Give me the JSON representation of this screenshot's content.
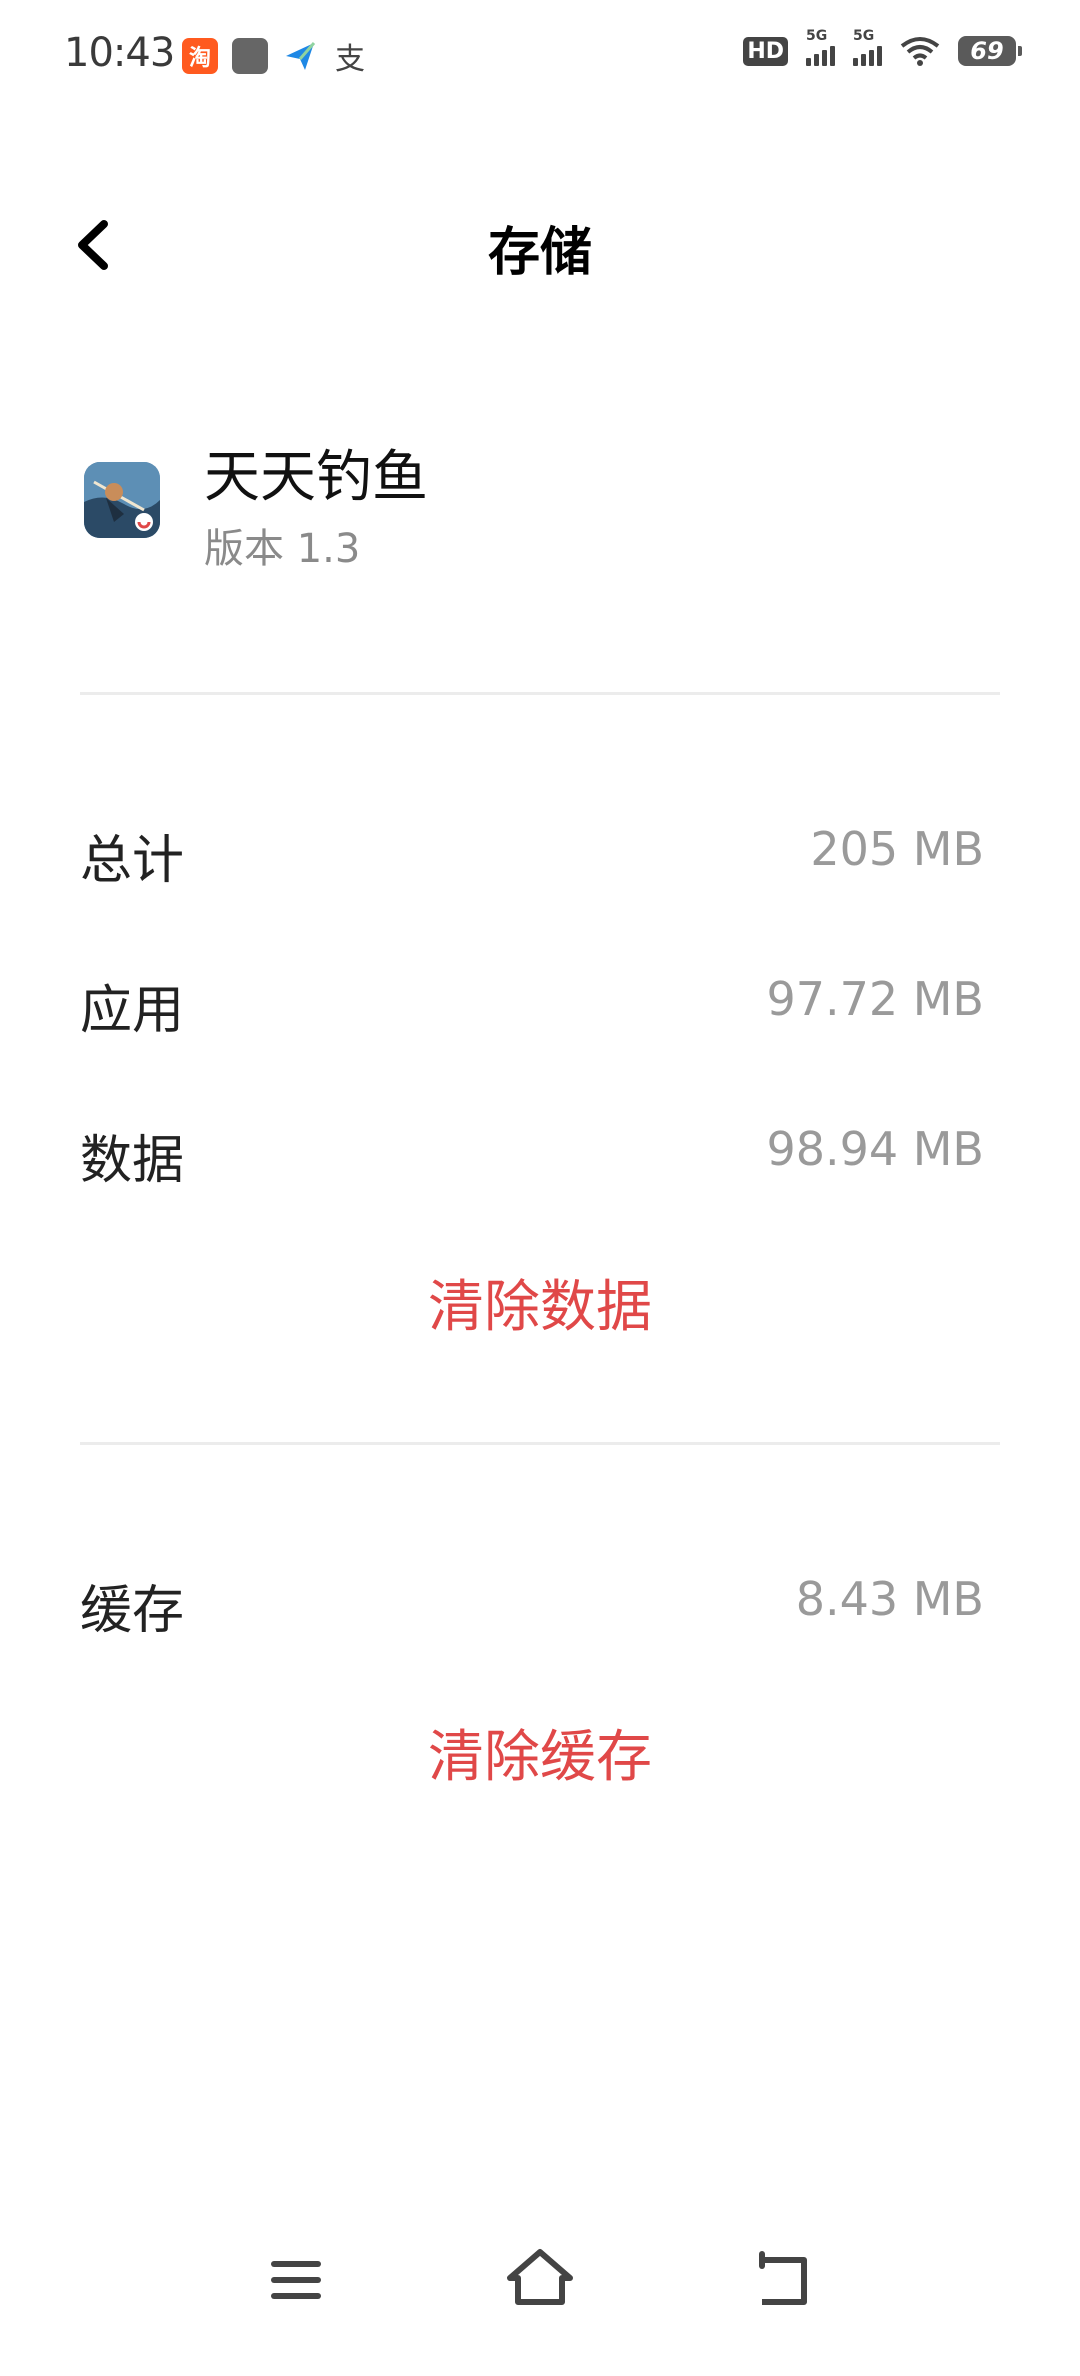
{
  "status_bar": {
    "time": "10:43",
    "notifications": [
      {
        "icon": "taobao-icon",
        "text": "淘"
      },
      {
        "icon": "gray-app-icon",
        "text": ""
      },
      {
        "icon": "send-arrow-icon",
        "text": ""
      },
      {
        "icon": "alipay-icon",
        "text": "支"
      }
    ],
    "hd_label": "HD",
    "network_label": "5G",
    "battery": "69"
  },
  "header": {
    "title": "存储"
  },
  "app": {
    "name": "天天钓鱼",
    "version": "版本 1.3"
  },
  "storage": {
    "rows": [
      {
        "label": "总计",
        "value": "205 MB"
      },
      {
        "label": "应用",
        "value": "97.72 MB"
      },
      {
        "label": "数据",
        "value": "98.94 MB"
      }
    ],
    "clear_data_label": "清除数据"
  },
  "cache": {
    "label": "缓存",
    "value": "8.43 MB",
    "clear_cache_label": "清除缓存"
  },
  "colors": {
    "accent_red": "#e04848",
    "value_gray": "#9a9a9a"
  }
}
